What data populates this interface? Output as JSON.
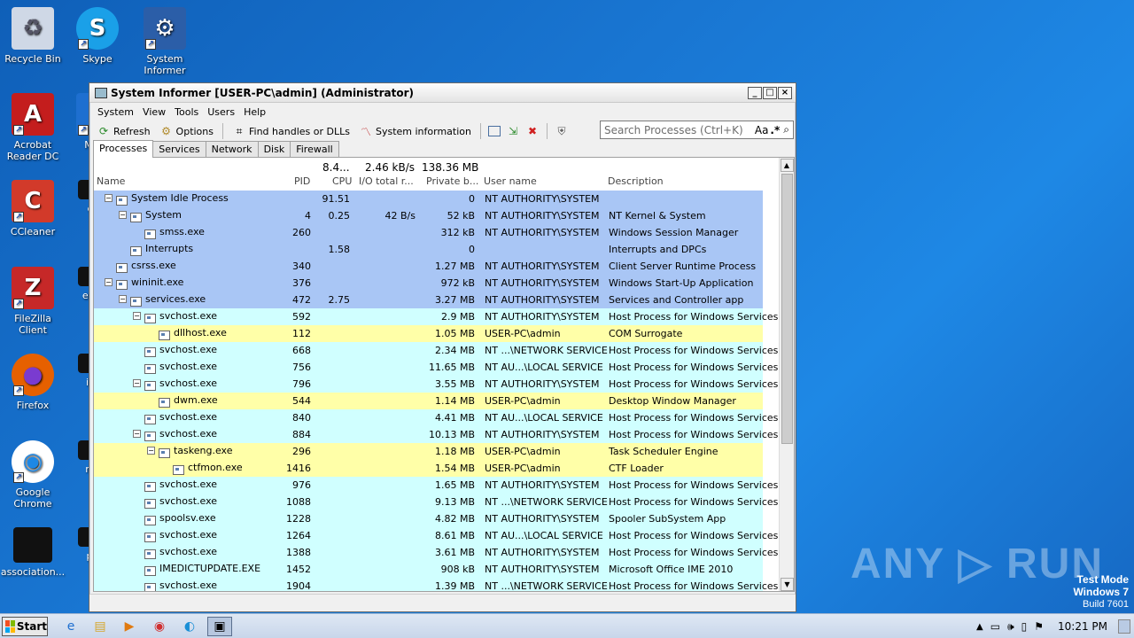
{
  "desktop": {
    "icons": [
      {
        "label": "Recycle Bin",
        "icon": "recycle-bin-icon"
      },
      {
        "label": "Skype",
        "icon": "skype-icon"
      },
      {
        "label": "System Informer",
        "icon": "system-informer-icon"
      },
      {
        "label": "Acrobat Reader DC",
        "icon": "acrobat-icon"
      },
      {
        "label": "Micro",
        "icon": "microsoft-edge-icon"
      },
      {
        "label": "CCleaner",
        "icon": "ccleaner-icon"
      },
      {
        "label": "club",
        "icon": "file-icon"
      },
      {
        "label": "FileZilla Client",
        "icon": "filezilla-icon"
      },
      {
        "label": "emplo",
        "icon": "file-icon"
      },
      {
        "label": "Firefox",
        "icon": "firefox-icon"
      },
      {
        "label": "inclu",
        "icon": "file-icon"
      },
      {
        "label": "Google Chrome",
        "icon": "chrome-icon"
      },
      {
        "label": "mobi",
        "icon": "file-icon"
      },
      {
        "label": "association...",
        "icon": "file-icon"
      },
      {
        "label": "phot",
        "icon": "file-icon"
      }
    ],
    "watermark": "ANY ▷ RUN",
    "test_mode": {
      "line1": "Test Mode",
      "line2": "Windows 7",
      "line3": "Build 7601"
    }
  },
  "window": {
    "title": "System Informer [USER-PC\\admin] (Administrator)",
    "controls": {
      "minimize": "_",
      "maximize": "□",
      "close": "×"
    },
    "menu": [
      "System",
      "View",
      "Tools",
      "Users",
      "Help"
    ],
    "toolbar": {
      "refresh": "Refresh",
      "options": "Options",
      "find_handles": "Find handles or DLLs",
      "system_information": "System information"
    },
    "search": {
      "placeholder": "Search Processes (Ctrl+K)",
      "case_toggle": "Aa",
      "regex_toggle": ".*"
    },
    "tabs": [
      "Processes",
      "Services",
      "Network",
      "Disk",
      "Firewall"
    ],
    "active_tab": "Processes",
    "summary": {
      "cpu": "8.4...",
      "io": "2.46 kB/s",
      "private": "138.36 MB"
    },
    "columns": [
      "Name",
      "PID",
      "CPU",
      "I/O total r...",
      "Private b...",
      "User name",
      "Description"
    ],
    "colors": {
      "system": "#a9c6f5",
      "service": "#d0ffff",
      "own": "#ffffa8"
    },
    "processes": [
      {
        "indent": 0,
        "exp": "−",
        "name": "System Idle Process",
        "pid": "",
        "cpu": "91.51",
        "io": "",
        "priv": "0",
        "user": "NT AUTHORITY\\SYSTEM",
        "desc": "",
        "kind": "system"
      },
      {
        "indent": 1,
        "exp": "−",
        "name": "System",
        "pid": "4",
        "cpu": "0.25",
        "io": "42 B/s",
        "priv": "52 kB",
        "user": "NT AUTHORITY\\SYSTEM",
        "desc": "NT Kernel & System",
        "kind": "system"
      },
      {
        "indent": 2,
        "exp": "",
        "name": "smss.exe",
        "pid": "260",
        "cpu": "",
        "io": "",
        "priv": "312 kB",
        "user": "NT AUTHORITY\\SYSTEM",
        "desc": "Windows Session Manager",
        "kind": "system"
      },
      {
        "indent": 1,
        "exp": "",
        "name": "Interrupts",
        "pid": "",
        "cpu": "1.58",
        "io": "",
        "priv": "0",
        "user": "",
        "desc": "Interrupts and DPCs",
        "kind": "system"
      },
      {
        "indent": 0,
        "exp": "",
        "name": "csrss.exe",
        "pid": "340",
        "cpu": "",
        "io": "",
        "priv": "1.27 MB",
        "user": "NT AUTHORITY\\SYSTEM",
        "desc": "Client Server Runtime Process",
        "kind": "system"
      },
      {
        "indent": 0,
        "exp": "−",
        "name": "wininit.exe",
        "pid": "376",
        "cpu": "",
        "io": "",
        "priv": "972 kB",
        "user": "NT AUTHORITY\\SYSTEM",
        "desc": "Windows Start-Up Application",
        "kind": "system"
      },
      {
        "indent": 1,
        "exp": "−",
        "name": "services.exe",
        "pid": "472",
        "cpu": "2.75",
        "io": "",
        "priv": "3.27 MB",
        "user": "NT AUTHORITY\\SYSTEM",
        "desc": "Services and Controller app",
        "kind": "system"
      },
      {
        "indent": 2,
        "exp": "−",
        "name": "svchost.exe",
        "pid": "592",
        "cpu": "",
        "io": "",
        "priv": "2.9 MB",
        "user": "NT AUTHORITY\\SYSTEM",
        "desc": "Host Process for Windows Services",
        "kind": "service"
      },
      {
        "indent": 3,
        "exp": "",
        "name": "dllhost.exe",
        "pid": "112",
        "cpu": "",
        "io": "",
        "priv": "1.05 MB",
        "user": "USER-PC\\admin",
        "desc": "COM Surrogate",
        "kind": "own"
      },
      {
        "indent": 2,
        "exp": "",
        "name": "svchost.exe",
        "pid": "668",
        "cpu": "",
        "io": "",
        "priv": "2.34 MB",
        "user": "NT ...\\NETWORK SERVICE",
        "desc": "Host Process for Windows Services",
        "kind": "service"
      },
      {
        "indent": 2,
        "exp": "",
        "name": "svchost.exe",
        "pid": "756",
        "cpu": "",
        "io": "",
        "priv": "11.65 MB",
        "user": "NT AU...\\LOCAL SERVICE",
        "desc": "Host Process for Windows Services",
        "kind": "service"
      },
      {
        "indent": 2,
        "exp": "−",
        "name": "svchost.exe",
        "pid": "796",
        "cpu": "",
        "io": "",
        "priv": "3.55 MB",
        "user": "NT AUTHORITY\\SYSTEM",
        "desc": "Host Process for Windows Services",
        "kind": "service"
      },
      {
        "indent": 3,
        "exp": "",
        "name": "dwm.exe",
        "pid": "544",
        "cpu": "",
        "io": "",
        "priv": "1.14 MB",
        "user": "USER-PC\\admin",
        "desc": "Desktop Window Manager",
        "kind": "own"
      },
      {
        "indent": 2,
        "exp": "",
        "name": "svchost.exe",
        "pid": "840",
        "cpu": "",
        "io": "",
        "priv": "4.41 MB",
        "user": "NT AU...\\LOCAL SERVICE",
        "desc": "Host Process for Windows Services",
        "kind": "service"
      },
      {
        "indent": 2,
        "exp": "−",
        "name": "svchost.exe",
        "pid": "884",
        "cpu": "",
        "io": "",
        "priv": "10.13 MB",
        "user": "NT AUTHORITY\\SYSTEM",
        "desc": "Host Process for Windows Services",
        "kind": "service"
      },
      {
        "indent": 3,
        "exp": "−",
        "name": "taskeng.exe",
        "pid": "296",
        "cpu": "",
        "io": "",
        "priv": "1.18 MB",
        "user": "USER-PC\\admin",
        "desc": "Task Scheduler Engine",
        "kind": "own"
      },
      {
        "indent": 4,
        "exp": "",
        "name": "ctfmon.exe",
        "pid": "1416",
        "cpu": "",
        "io": "",
        "priv": "1.54 MB",
        "user": "USER-PC\\admin",
        "desc": "CTF Loader",
        "kind": "own",
        "icon": "pencil-doc-icon"
      },
      {
        "indent": 2,
        "exp": "",
        "name": "svchost.exe",
        "pid": "976",
        "cpu": "",
        "io": "",
        "priv": "1.65 MB",
        "user": "NT AUTHORITY\\SYSTEM",
        "desc": "Host Process for Windows Services",
        "kind": "service"
      },
      {
        "indent": 2,
        "exp": "",
        "name": "svchost.exe",
        "pid": "1088",
        "cpu": "",
        "io": "",
        "priv": "9.13 MB",
        "user": "NT ...\\NETWORK SERVICE",
        "desc": "Host Process for Windows Services",
        "kind": "service"
      },
      {
        "indent": 2,
        "exp": "",
        "name": "spoolsv.exe",
        "pid": "1228",
        "cpu": "",
        "io": "",
        "priv": "4.82 MB",
        "user": "NT AUTHORITY\\SYSTEM",
        "desc": "Spooler SubSystem App",
        "kind": "service"
      },
      {
        "indent": 2,
        "exp": "",
        "name": "svchost.exe",
        "pid": "1264",
        "cpu": "",
        "io": "",
        "priv": "8.61 MB",
        "user": "NT AU...\\LOCAL SERVICE",
        "desc": "Host Process for Windows Services",
        "kind": "service"
      },
      {
        "indent": 2,
        "exp": "",
        "name": "svchost.exe",
        "pid": "1388",
        "cpu": "",
        "io": "",
        "priv": "3.61 MB",
        "user": "NT AUTHORITY\\SYSTEM",
        "desc": "Host Process for Windows Services",
        "kind": "service"
      },
      {
        "indent": 2,
        "exp": "",
        "name": "IMEDICTUPDATE.EXE",
        "pid": "1452",
        "cpu": "",
        "io": "",
        "priv": "908 kB",
        "user": "NT AUTHORITY\\SYSTEM",
        "desc": "Microsoft Office IME 2010",
        "kind": "service"
      },
      {
        "indent": 2,
        "exp": "",
        "name": "svchost.exe",
        "pid": "1904",
        "cpu": "",
        "io": "",
        "priv": "1.39 MB",
        "user": "NT ...\\NETWORK SERVICE",
        "desc": "Host Process for Windows Services",
        "kind": "service"
      }
    ]
  },
  "taskbar": {
    "start_label": "Start",
    "apps": [
      "internet-explorer-icon",
      "explorer-icon",
      "media-player-icon",
      "chrome-icon",
      "edge-icon",
      "system-informer-icon"
    ],
    "clock": "10:21 PM"
  }
}
